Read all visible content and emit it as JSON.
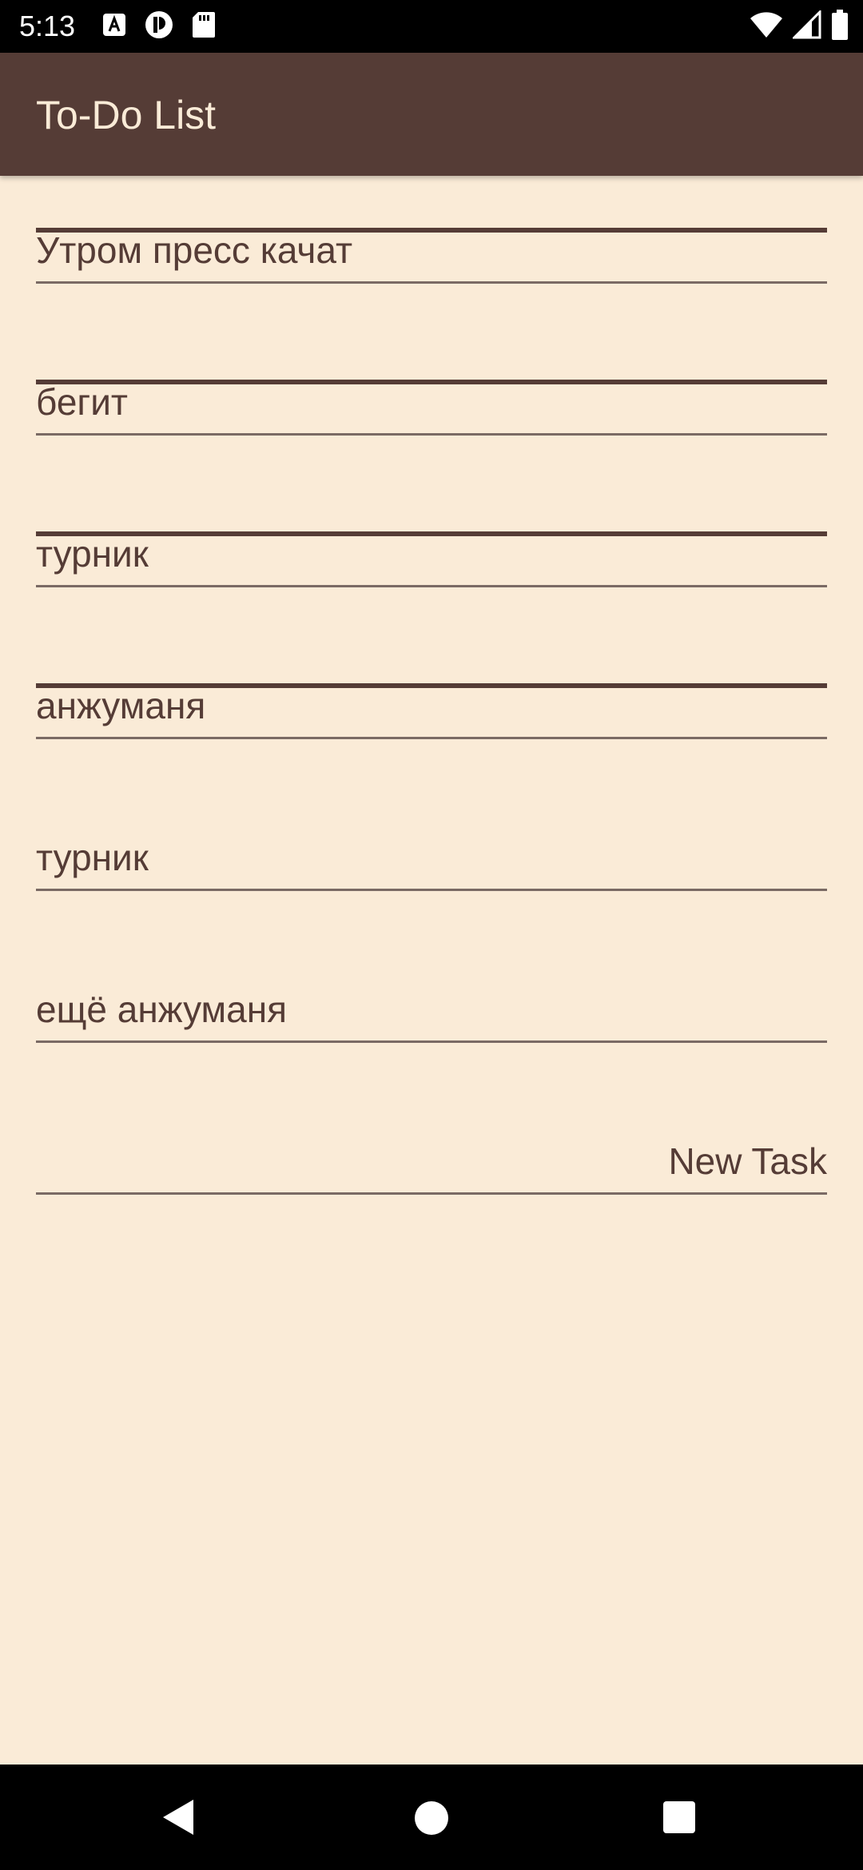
{
  "status_bar": {
    "time": "5:13",
    "left_icons": [
      "a-notification-icon",
      "sync-notification-icon",
      "sd-card-icon"
    ],
    "right_icons": [
      "wifi-icon",
      "signal-icon",
      "battery-icon"
    ]
  },
  "app_bar": {
    "title": "To-Do List"
  },
  "tasks": [
    {
      "text": "Утром пресс качат",
      "done": true
    },
    {
      "text": "бегит",
      "done": true
    },
    {
      "text": "турник",
      "done": true
    },
    {
      "text": "анжуманя",
      "done": true
    },
    {
      "text": "турник",
      "done": false
    },
    {
      "text": "ещё анжуманя",
      "done": false
    }
  ],
  "new_task": {
    "placeholder": "New Task"
  },
  "nav_bar": {
    "buttons": [
      "back-icon",
      "home-icon",
      "recent-apps-icon"
    ]
  },
  "colors": {
    "background": "#faebd7",
    "app_bar": "#553c36",
    "title_text": "#faebd7",
    "task_text": "#553c36"
  }
}
